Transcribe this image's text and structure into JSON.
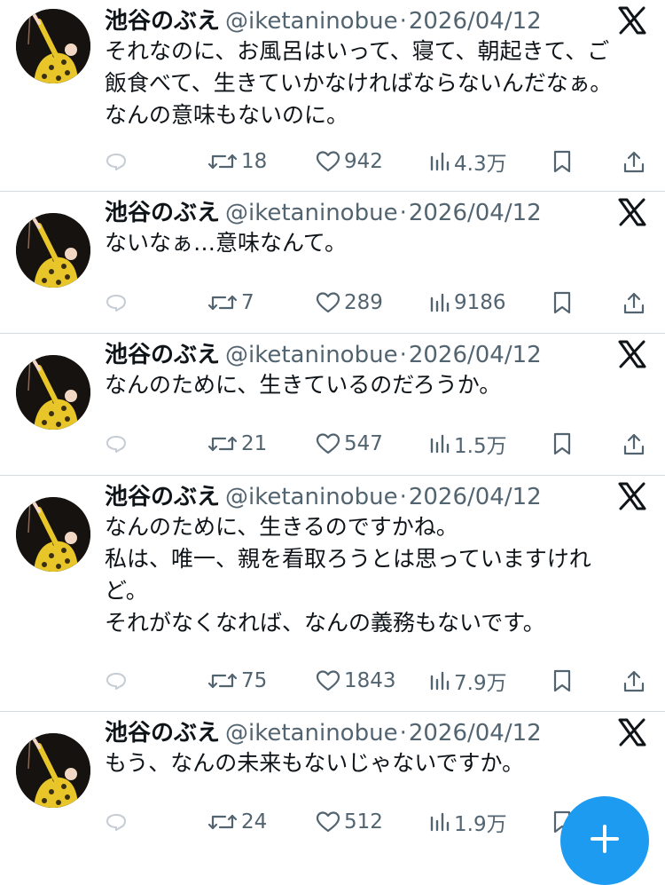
{
  "posts": [
    {
      "name": "池谷のぶえ",
      "handle": "@iketaninobue",
      "separator": "·",
      "date": "2026/04/12",
      "lines": [
        "それなのに、お風呂はいって、寝て、朝起きて、ご",
        "飯食べて、生きていかなければならないんだなぁ。",
        "なんの意味もないのに。"
      ],
      "reposts": "18",
      "likes": "942",
      "views": "4.3万"
    },
    {
      "name": "池谷のぶえ",
      "handle": "@iketaninobue",
      "separator": "·",
      "date": "2026/04/12",
      "lines": [
        "ないなぁ…意味なんて。"
      ],
      "reposts": "7",
      "likes": "289",
      "views": "9186"
    },
    {
      "name": "池谷のぶえ",
      "handle": "@iketaninobue",
      "separator": "·",
      "date": "2026/04/12",
      "lines": [
        "なんのために、生きているのだろうか。"
      ],
      "reposts": "21",
      "likes": "547",
      "views": "1.5万"
    },
    {
      "name": "池谷のぶえ",
      "handle": "@iketaninobue",
      "separator": "·",
      "date": "2026/04/12",
      "lines": [
        "なんのために、生きるのですかね。",
        "私は、唯一、親を看取ろうとは思っていますけれ",
        "ど。",
        "それがなくなれば、なんの義務もないです。"
      ],
      "reposts": "75",
      "likes": "1843",
      "views": "7.9万"
    },
    {
      "name": "池谷のぶえ",
      "handle": "@iketaninobue",
      "separator": "·",
      "date": "2026/04/12",
      "lines": [
        "もう、なんの未来もないじゃないですか。"
      ],
      "reposts": "24",
      "likes": "512",
      "views": "1.9万"
    }
  ],
  "icons": {
    "avatar": "avatar-photo",
    "source": "x-logo-icon",
    "reply": "reply-icon",
    "repost": "repost-icon",
    "like": "heart-icon",
    "views": "views-chart-icon",
    "bookmark": "bookmark-icon",
    "share": "share-icon",
    "compose": "plus-icon"
  },
  "colors": {
    "text": "#0f1419",
    "secondary": "#536471",
    "divider": "#d6dbe0",
    "accent": "#1d9bf0",
    "avatar_yellow": "#e8c62a"
  }
}
